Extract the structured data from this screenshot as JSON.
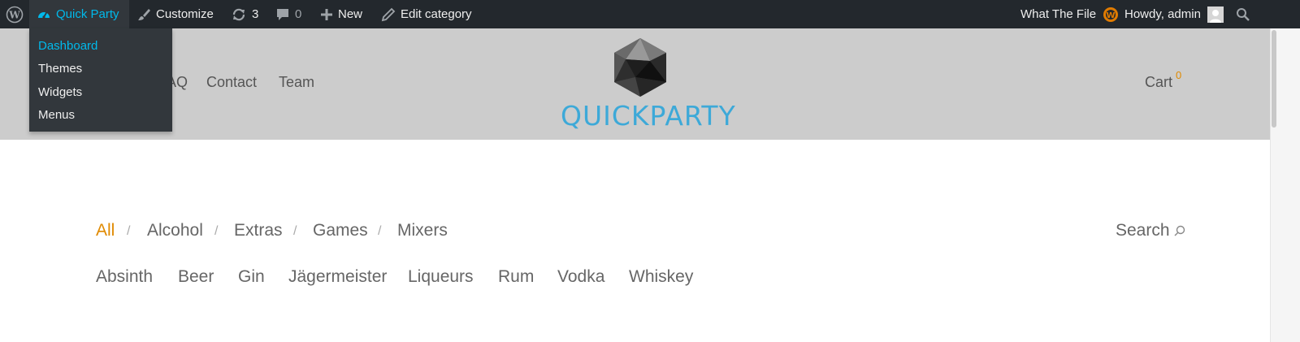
{
  "adminbar": {
    "site_name": "Quick Party",
    "customize": "Customize",
    "updates_count": "3",
    "comments_count": "0",
    "new": "New",
    "edit_category": "Edit category",
    "what_the_file": "What The File",
    "howdy": "Howdy, admin"
  },
  "dropdown": {
    "items": [
      "Dashboard",
      "Themes",
      "Widgets",
      "Menus"
    ]
  },
  "header": {
    "nav": [
      "AQ",
      "Contact",
      "Team"
    ],
    "logo_text": "QUICKPARTY",
    "cart_label": "Cart",
    "cart_count": "0"
  },
  "filters": {
    "primary": [
      "All",
      "Alcohol",
      "Extras",
      "Games",
      "Mixers"
    ],
    "separator": "/",
    "search_label": "Search",
    "sub": [
      "Absinth",
      "Beer",
      "Gin",
      "Jägermeister",
      "Liqueurs",
      "Rum",
      "Vodka",
      "Whiskey"
    ]
  },
  "colors": {
    "adminbar_bg": "#23282d",
    "admin_accent": "#00b9eb",
    "header_bg": "#cccccc",
    "brand_blue": "#3da9d8",
    "active_orange": "#e08a00"
  }
}
